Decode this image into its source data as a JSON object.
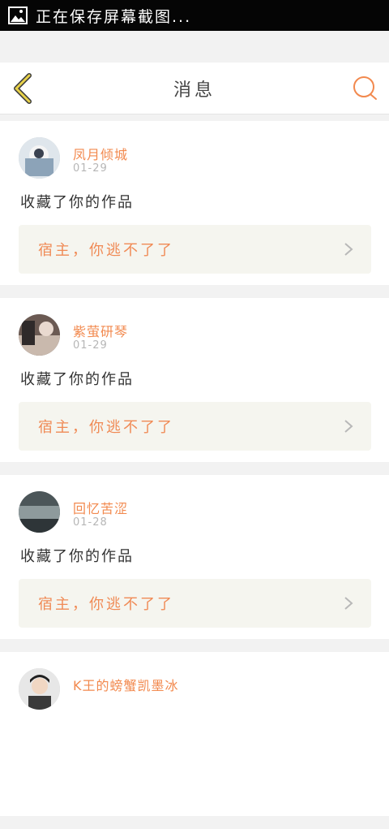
{
  "status_bar": {
    "text": "正在保存屏幕截图..."
  },
  "header": {
    "title": "消息"
  },
  "messages": [
    {
      "user": "凤月倾城",
      "date": "01-29",
      "action": "收藏了你的作品",
      "work": "宿主，你逃不了了"
    },
    {
      "user": "紫萤研琴",
      "date": "01-29",
      "action": "收藏了你的作品",
      "work": "宿主，你逃不了了"
    },
    {
      "user": "回忆苦涩",
      "date": "01-28",
      "action": "收藏了你的作品",
      "work": "宿主，你逃不了了"
    },
    {
      "user": "K王的螃蟹凯墨冰",
      "date": "",
      "action": "",
      "work": ""
    }
  ],
  "colors": {
    "accent": "#f2894e",
    "back_icon": "#e8d24a"
  }
}
